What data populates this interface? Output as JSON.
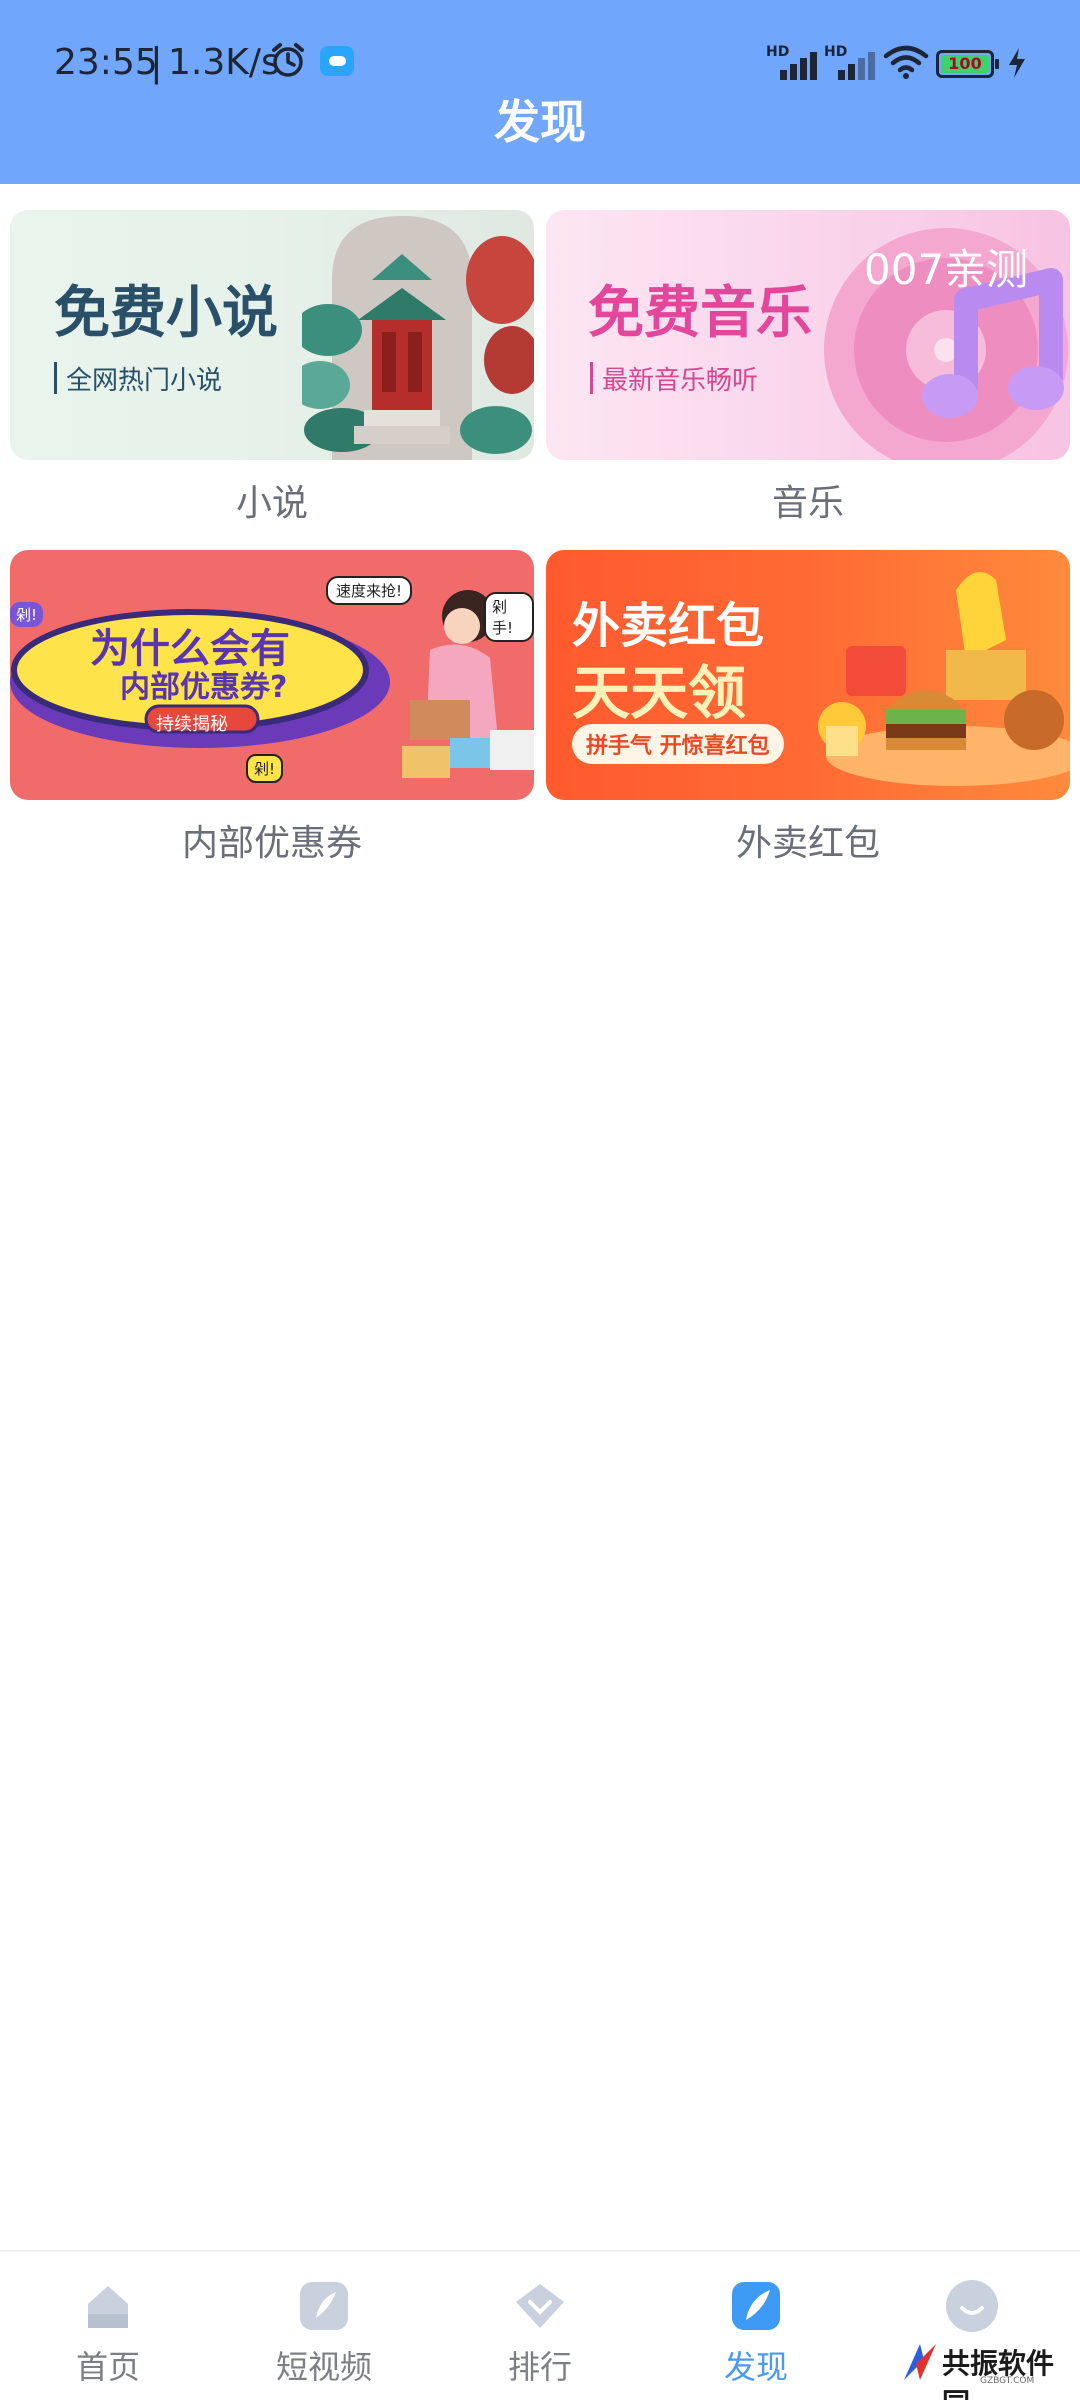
{
  "status_bar": {
    "time": "23:55",
    "separator": "|",
    "net_speed": "1.3K/s",
    "signal_1_label": "HD",
    "signal_2_label": "HD",
    "battery_level": "100",
    "icons": [
      "alarm-icon",
      "cloud-icon",
      "signal-icon",
      "signal-icon",
      "wifi-icon",
      "battery-icon",
      "charging-icon"
    ]
  },
  "header": {
    "title": "发现"
  },
  "cards": [
    {
      "id": "novel",
      "banner_title": "免费小说",
      "banner_sub": "全网热门小说",
      "label": "小说"
    },
    {
      "id": "music",
      "banner_title": "免费音乐",
      "banner_sub": "最新音乐畅听",
      "banner_tag": "007亲测",
      "label": "音乐"
    },
    {
      "id": "coupon",
      "banner_title_1": "为什么会有",
      "banner_title_2": "内部优惠券?",
      "banner_sub": "持续揭秘",
      "bubble_1": "速度来抢!",
      "bubble_2": "剁手!",
      "bubble_3": "剁!",
      "bubble_4": "剁!",
      "label": "内部优惠券"
    },
    {
      "id": "takeout",
      "banner_title_1": "外卖红包",
      "banner_title_2": "天天领",
      "banner_sub": "拼手气 开惊喜红包",
      "label": "外卖红包"
    }
  ],
  "bottom_nav": {
    "items": [
      {
        "label": "首页",
        "icon": "home-icon",
        "active": false
      },
      {
        "label": "短视频",
        "icon": "short-video-icon",
        "active": false
      },
      {
        "label": "排行",
        "icon": "ranking-icon",
        "active": false
      },
      {
        "label": "发现",
        "icon": "discover-icon",
        "active": true
      },
      {
        "label": "",
        "icon": "profile-icon",
        "active": false
      }
    ]
  },
  "watermark": {
    "text": "共振软件园",
    "sub": "GZBGT.COM"
  },
  "colors": {
    "header": "#70a6fb",
    "active_tab": "#4a9af0",
    "inactive_tab": "#7c7f86"
  }
}
